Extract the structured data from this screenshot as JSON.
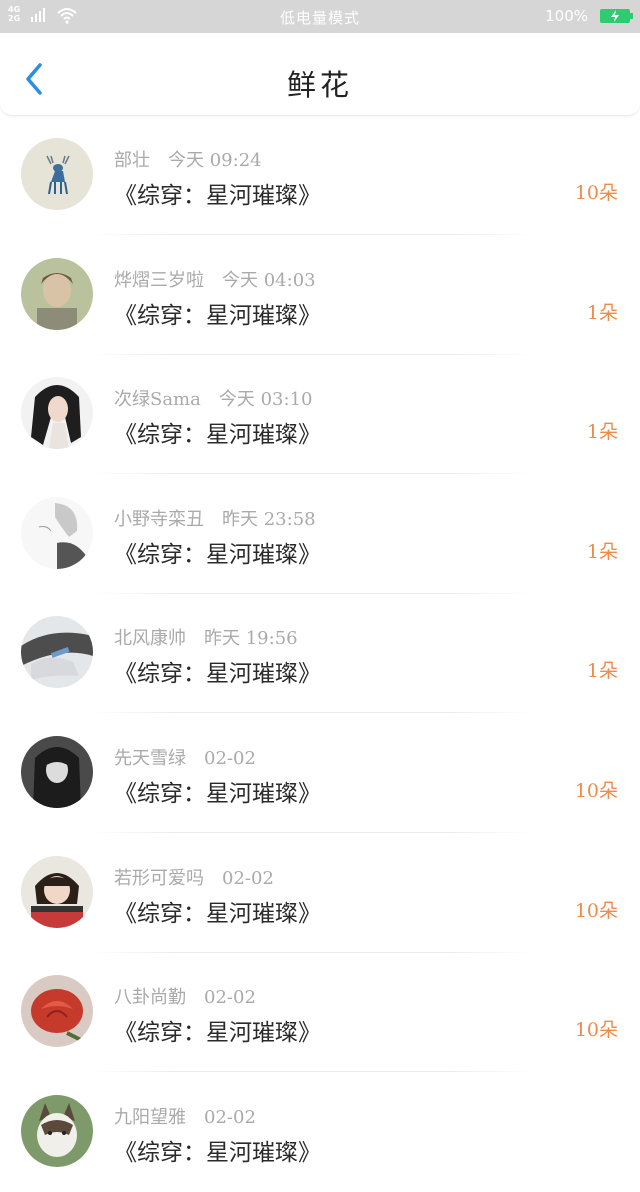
{
  "status_bar": {
    "network_top": "4G",
    "network_bottom": "2G",
    "mode": "低电量模式",
    "battery": "100%"
  },
  "header": {
    "title": "鲜花"
  },
  "items": [
    {
      "user": "部壮",
      "time": "今天 09:24",
      "book": "《综穿：星河璀璨》",
      "count": "10朵",
      "avatar": "deer-illustration"
    },
    {
      "user": "烨熠三岁啦",
      "time": "今天 04:03",
      "book": "《综穿：星河璀璨》",
      "count": "1朵",
      "avatar": "young-man-photo"
    },
    {
      "user": "次绿Sama",
      "time": "今天 03:10",
      "book": "《综穿：星河璀璨》",
      "count": "1朵",
      "avatar": "anime-girl"
    },
    {
      "user": "小野寺栾丑",
      "time": "昨天 23:58",
      "book": "《综穿：星河璀璨》",
      "count": "1朵",
      "avatar": "sketch-figure"
    },
    {
      "user": "北风康帅",
      "time": "昨天 19:56",
      "book": "《综穿：星河璀璨》",
      "count": "1朵",
      "avatar": "hand-photo"
    },
    {
      "user": "先天雪绿",
      "time": "02-02",
      "book": "《综穿：星河璀璨》",
      "count": "10朵",
      "avatar": "dark-hair-girl"
    },
    {
      "user": "若形可爱吗",
      "time": "02-02",
      "book": "《综穿：星河璀璨》",
      "count": "10朵",
      "avatar": "child-photo"
    },
    {
      "user": "八卦尚勤",
      "time": "02-02",
      "book": "《综穿：星河璀璨》",
      "count": "10朵",
      "avatar": "red-rose"
    },
    {
      "user": "九阳望雅",
      "time": "02-02",
      "book": "《综穿：星河璀璨》",
      "count": "",
      "avatar": "husky-dog"
    }
  ],
  "colors": {
    "accent": "#2b8fe0",
    "count": "#f08a4b",
    "status_bar": "#d6d6d6",
    "battery": "#2ecc71"
  }
}
